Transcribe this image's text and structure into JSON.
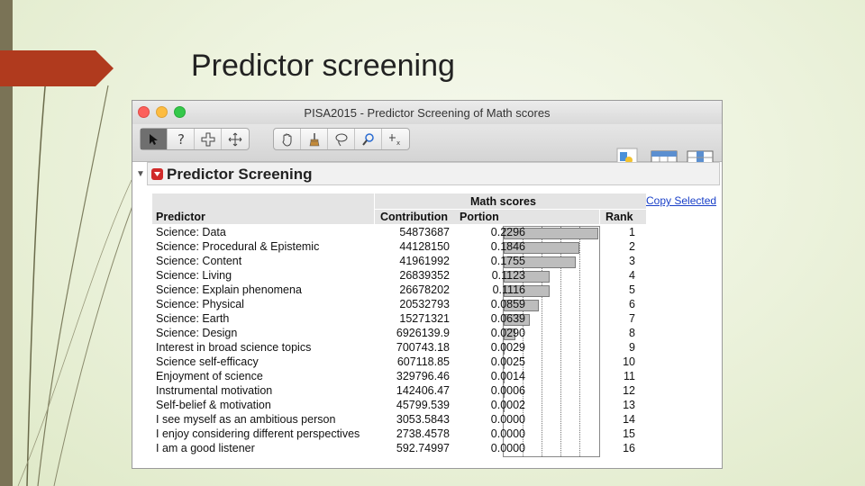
{
  "slide": {
    "title": "Predictor screening"
  },
  "window": {
    "title": "PISA2015 - Predictor Screening of Math scores"
  },
  "toolbar": {
    "icons": [
      "arrow-pointer-icon",
      "help-icon",
      "crosshair-icon",
      "move-icon",
      "hand-icon",
      "brush-icon",
      "lasso-icon",
      "magnifier-icon",
      "annotate-icon",
      "jmp-home-icon",
      "data-table-icon",
      "column-icon"
    ]
  },
  "report": {
    "title": "Predictor Screening",
    "copy_label": "Copy Selected",
    "group_header": "Math scores",
    "columns": {
      "predictor": "Predictor",
      "contribution": "Contribution",
      "portion": "Portion",
      "rank": "Rank"
    },
    "rows": [
      {
        "predictor": "Science: Data",
        "contribution": "54873687",
        "portion": "0.2296",
        "rank": "1"
      },
      {
        "predictor": "Science: Procedural & Epistemic",
        "contribution": "44128150",
        "portion": "0.1846",
        "rank": "2"
      },
      {
        "predictor": "Science: Content",
        "contribution": "41961992",
        "portion": "0.1755",
        "rank": "3"
      },
      {
        "predictor": "Science: Living",
        "contribution": "26839352",
        "portion": "0.1123",
        "rank": "4"
      },
      {
        "predictor": "Science: Explain phenomena",
        "contribution": "26678202",
        "portion": "0.1116",
        "rank": "5"
      },
      {
        "predictor": "Science: Physical",
        "contribution": "20532793",
        "portion": "0.0859",
        "rank": "6"
      },
      {
        "predictor": "Science: Earth",
        "contribution": "15271321",
        "portion": "0.0639",
        "rank": "7"
      },
      {
        "predictor": "Science: Design",
        "contribution": "6926139.9",
        "portion": "0.0290",
        "rank": "8"
      },
      {
        "predictor": "Interest in broad science topics",
        "contribution": "700743.18",
        "portion": "0.0029",
        "rank": "9"
      },
      {
        "predictor": "Science self-efficacy",
        "contribution": "607118.85",
        "portion": "0.0025",
        "rank": "10"
      },
      {
        "predictor": "Enjoyment of science",
        "contribution": "329796.46",
        "portion": "0.0014",
        "rank": "11"
      },
      {
        "predictor": "Instrumental motivation",
        "contribution": "142406.47",
        "portion": "0.0006",
        "rank": "12"
      },
      {
        "predictor": "Self-belief & motivation",
        "contribution": "45799.539",
        "portion": "0.0002",
        "rank": "13"
      },
      {
        "predictor": "I see myself as an ambitious person",
        "contribution": "3053.5843",
        "portion": "0.0000",
        "rank": "14"
      },
      {
        "predictor": "I enjoy considering different perspectives",
        "contribution": "2738.4578",
        "portion": "0.0000",
        "rank": "15"
      },
      {
        "predictor": "I am a good listener",
        "contribution": "592.74997",
        "portion": "0.0000",
        "rank": "16"
      }
    ]
  },
  "colors": {
    "accent": "#b03a1e",
    "link": "#1a40c8",
    "bar_fill": "#bdbdbd"
  }
}
